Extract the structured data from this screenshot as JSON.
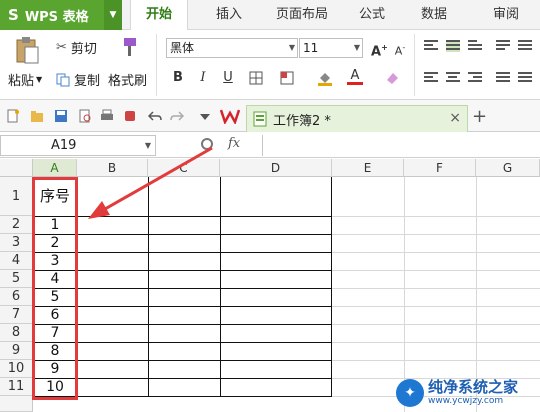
{
  "app": {
    "name": "WPS 表格",
    "logo_glyph": "S"
  },
  "menu": {
    "tabs": [
      {
        "label": "开始",
        "active": true
      },
      {
        "label": "插入"
      },
      {
        "label": "页面布局"
      },
      {
        "label": "公式"
      },
      {
        "label": "数据"
      },
      {
        "label": "审阅"
      }
    ]
  },
  "ribbon": {
    "paste": "粘贴",
    "cut": "剪切",
    "copy": "复制",
    "format_painter": "格式刷",
    "font_name": "黑体",
    "font_size": "11",
    "bold": "B",
    "italic": "I",
    "underline": "U",
    "grow_font": "A",
    "shrink_font": "A",
    "font_color_glyph": "A"
  },
  "doc_tab": {
    "title": "工作簿2 *",
    "close": "×",
    "new_tab": "+"
  },
  "formula_bar": {
    "name_box": "A19",
    "fx": "fx",
    "value": ""
  },
  "sheet": {
    "columns": [
      "A",
      "B",
      "C",
      "D",
      "E",
      "F",
      "G"
    ],
    "selected_column": "A",
    "rows": [
      "1",
      "2",
      "3",
      "4",
      "5",
      "6",
      "7",
      "8",
      "9",
      "10",
      "11"
    ],
    "column_a_values": [
      "序号",
      "1",
      "2",
      "3",
      "4",
      "5",
      "6",
      "7",
      "8",
      "9",
      "10"
    ]
  },
  "watermark": {
    "line1": "纯净系统之家",
    "line2": "www.ycwjzy.com"
  },
  "colors": {
    "accent_green": "#5aa52f",
    "annotation_red": "#e23b3b"
  }
}
